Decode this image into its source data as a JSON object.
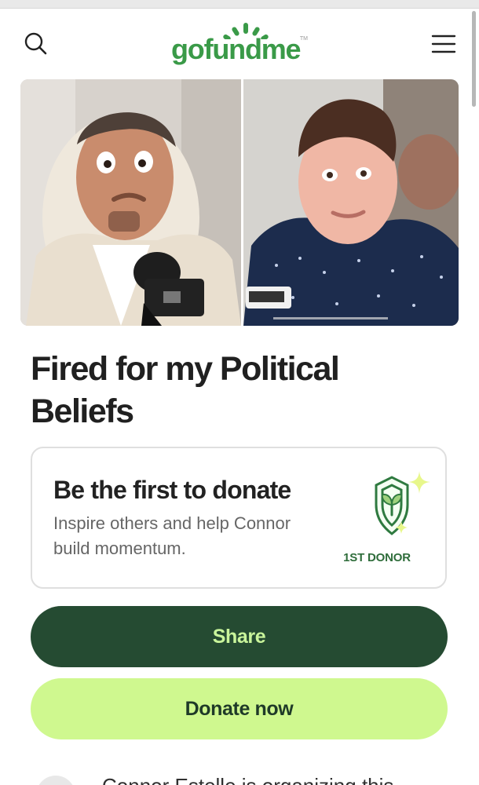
{
  "header": {
    "logo_text": "gofundme",
    "logo_mark": "TM",
    "search_icon": "search-icon",
    "menu_icon": "hamburger-menu-icon",
    "brand_color": "#3a9a48"
  },
  "campaign": {
    "title": "Fired for my Political Beliefs",
    "hero_image": {
      "left_subject": "man in beige jacket with microphone",
      "right_subject": "young man in dark polka-dot shirt with microphone"
    }
  },
  "donation_prompt": {
    "title": "Be the first to donate",
    "text": "Inspire others and help Connor build momentum.",
    "badge_label": "1ST DONOR",
    "badge_icon": "first-donor-shield-icon",
    "sparkle_color": "#e8f78b"
  },
  "actions": {
    "share_label": "Share",
    "donate_label": "Donate now",
    "share_color": "#254b32",
    "donate_color": "#cff88f"
  },
  "organizer": {
    "text": "Connor Estelle is organizing this"
  }
}
